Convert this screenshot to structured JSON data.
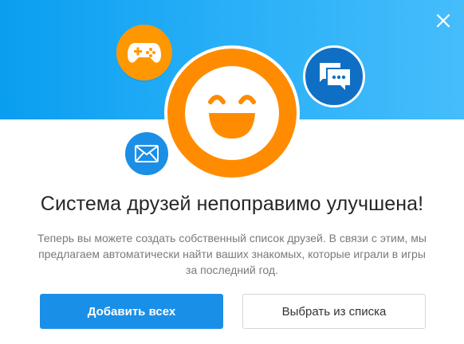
{
  "dialog": {
    "title": "Система друзей непоправимо улучшена!",
    "description_line1": "Теперь вы можете создать собственный список друзей. В связи с этим, мы",
    "description_line2": "предлагаем автоматически найти ваших знакомых, которые играли в игры",
    "description_line3": "за последний год.",
    "primary_button": "Добавить всех",
    "secondary_button": "Выбрать из списка"
  },
  "icons": {
    "close": "close-icon",
    "gamepad": "gamepad-icon",
    "chat": "chat-icon",
    "mail": "mail-icon",
    "smiley": "smiley-icon"
  },
  "colors": {
    "banner": "#26aef7",
    "orange": "#ff8c00",
    "primary_button": "#1a8fe8",
    "chat_bubble": "#0f6fc4",
    "mail_bubble": "#1b8fe6"
  }
}
